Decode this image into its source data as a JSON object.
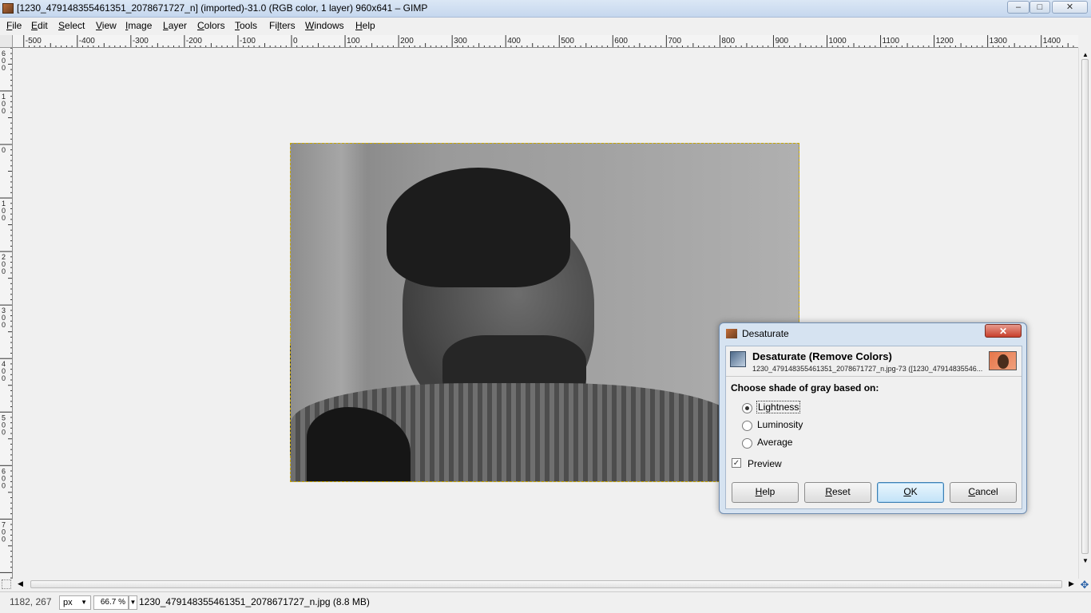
{
  "window": {
    "title": "[1230_479148355461351_2078671727_n] (imported)-31.0 (RGB color, 1 layer) 960x641 – GIMP",
    "minimize_label": "–",
    "maximize_label": "□",
    "close_label": "✕"
  },
  "menu": [
    {
      "mn": "F",
      "rest": "ile"
    },
    {
      "mn": "E",
      "rest": "dit"
    },
    {
      "mn": "S",
      "rest": "elect"
    },
    {
      "mn": "V",
      "rest": "iew"
    },
    {
      "mn": "I",
      "rest": "mage"
    },
    {
      "mn": "L",
      "rest": "ayer"
    },
    {
      "mn": "C",
      "rest": "olors"
    },
    {
      "mn": "T",
      "rest": "ools"
    },
    {
      "mn": "",
      "rest": "Filters",
      "u_index": 3
    },
    {
      "mn": "W",
      "rest": "indows"
    },
    {
      "mn": "H",
      "rest": "elp"
    }
  ],
  "ruler": {
    "h_labels": [
      "-500",
      "-400",
      "-300",
      "-200",
      "-100",
      "0",
      "100",
      "200",
      "300",
      "400",
      "500",
      "600",
      "700",
      "800",
      "900",
      "1000",
      "1100",
      "1200",
      "1300",
      "1400"
    ],
    "v_labels": [
      "600",
      "100",
      "0",
      "100",
      "200",
      "300",
      "400",
      "500",
      "600",
      "700"
    ]
  },
  "dialog": {
    "title": "Desaturate",
    "close_label": "✕",
    "heading": "Desaturate (Remove Colors)",
    "subheading": "1230_479148355461351_2078671727_n.jpg-73 ([1230_47914835546...",
    "prompt": "Choose shade of gray based on:",
    "options": [
      {
        "label": "Lightness",
        "selected": true
      },
      {
        "label": "Luminosity",
        "selected": false
      },
      {
        "label": "Average",
        "selected": false
      }
    ],
    "preview_label": "Preview",
    "preview_checked": true,
    "buttons": {
      "help": {
        "mn": "H",
        "rest": "elp"
      },
      "reset": {
        "mn": "R",
        "rest": "eset"
      },
      "ok": {
        "mn": "O",
        "rest": "K"
      },
      "cancel": {
        "mn": "C",
        "rest": "ancel"
      }
    }
  },
  "status": {
    "coords": "1182, 267",
    "unit": "px",
    "zoom": "66.7 %",
    "file": "1230_479148355461351_2078671727_n.jpg (8.8 MB)"
  },
  "colors": {
    "selection_outline": "#c8a800",
    "dialog_frame": "#d6e3f1",
    "close_button": "#c8402c"
  }
}
